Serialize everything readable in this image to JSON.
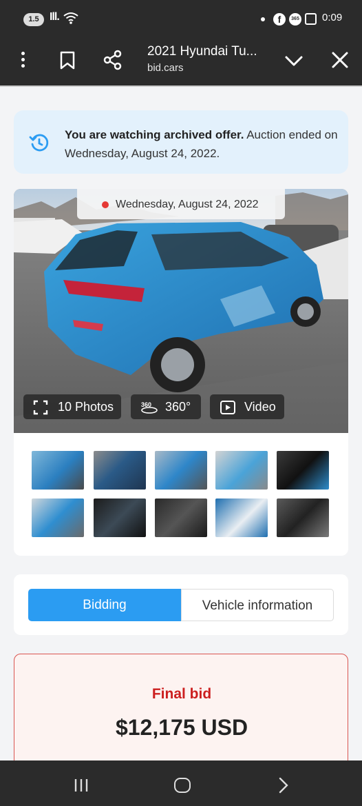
{
  "status_bar": {
    "badge": "1.5",
    "signal": "Ill.",
    "time": "0:09",
    "icons": [
      "wifi-icon",
      "notification-dot-icon",
      "facebook-icon",
      "app-365-icon",
      "screenshot-icon"
    ]
  },
  "toolbar": {
    "title": "2021 Hyundai Tu...",
    "url": "bid.cars",
    "icons": [
      "more-vert-icon",
      "bookmark-icon",
      "share-icon",
      "chevron-down-icon",
      "close-icon"
    ]
  },
  "notice": {
    "bold": "You are watching archived offer.",
    "text": " Auction ended on Wednesday, August 24, 2022.",
    "icon": "history-icon",
    "colors": {
      "background": "#e3f1fc",
      "icon": "#2b9cf2"
    }
  },
  "gallery": {
    "date": "Wednesday, August 24, 2022",
    "photos_label": "10 Photos",
    "degree_label": "360°",
    "video_label": "Video",
    "badge_360": "360",
    "thumbnail_count": 10
  },
  "tabs": [
    {
      "label": "Bidding",
      "active": true
    },
    {
      "label": "Vehicle information",
      "active": false
    }
  ],
  "final_bid": {
    "label": "Final bid",
    "value": "$12,175 USD",
    "colors": {
      "accent": "#cc1f1f",
      "background": "#fdf3f1"
    }
  },
  "colors": {
    "primary": "#2b9cf2",
    "bar": "#2b2b2b"
  },
  "nav_bar": {
    "icons": [
      "recent-apps-icon",
      "home-icon",
      "back-icon"
    ]
  }
}
